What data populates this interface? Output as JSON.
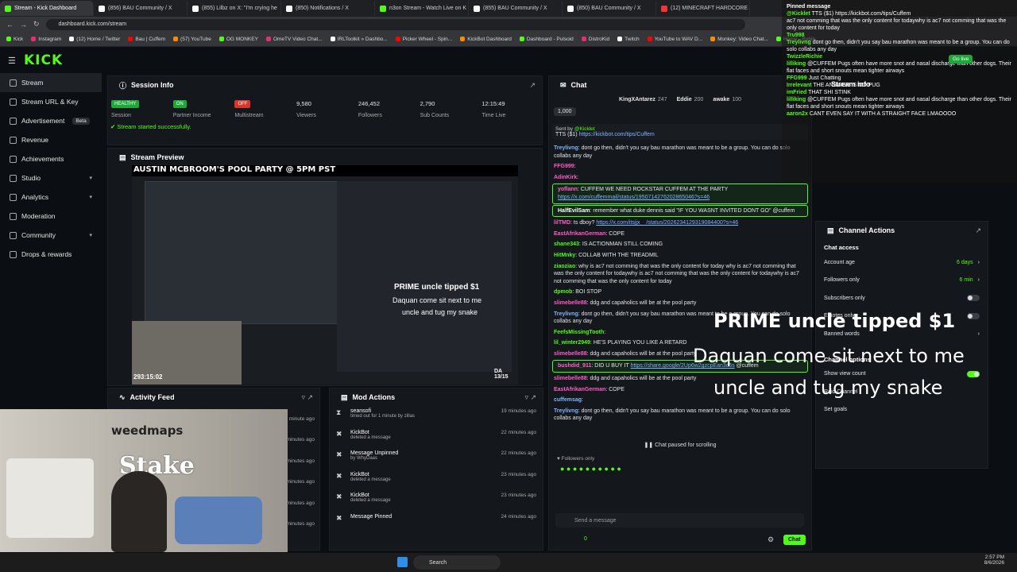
{
  "browser": {
    "tabs": [
      {
        "label": "Stream - Kick Dashboard",
        "color": "#53fc18",
        "active": true
      },
      {
        "label": "(856) BAU Community / X",
        "color": "#ffffff"
      },
      {
        "label": "(855) Lilbz on X: \"I'm crying he",
        "color": "#ffffff"
      },
      {
        "label": "(850) Notifications / X",
        "color": "#ffffff"
      },
      {
        "label": "n3on Stream - Watch Live on K",
        "color": "#53fc18"
      },
      {
        "label": "(855) BAU Community / X",
        "color": "#ffffff"
      },
      {
        "label": "(850) BAU Community / X",
        "color": "#ffffff"
      },
      {
        "label": "(12) MINECRAFT HARDCORE A",
        "color": "#ff3333"
      }
    ],
    "url": "dashboard.kick.com/stream",
    "bookmarks": [
      "Kick",
      "Instagram",
      "(12) Home / Twitter",
      "Bau | Cuffem",
      "(57) YouTube",
      "OG MONKEY",
      "OmeTV Video Chat...",
      "IRLToolkit » Dashbo...",
      "Picker Wheel - Spin...",
      "KickBot Dashboard",
      "Dashboard - Pulsoid",
      "DistroKid",
      "Twitch",
      "YouTube to WAV D...",
      "Monkey: Video Chat...",
      "Home - Rubik..."
    ]
  },
  "brand": {
    "logo": "KICK",
    "accent": "#53fc18"
  },
  "sidebar": {
    "items": [
      {
        "label": "Stream",
        "active": true,
        "icon": "stream-icon"
      },
      {
        "label": "Stream URL & Key",
        "icon": "key-icon"
      },
      {
        "label": "Advertisement",
        "badge": "Beta",
        "icon": "ad-icon"
      },
      {
        "label": "Revenue",
        "icon": "revenue-icon"
      },
      {
        "label": "Achievements",
        "icon": "trophy-icon"
      },
      {
        "label": "Studio",
        "chevron": true,
        "icon": "studio-icon"
      },
      {
        "label": "Analytics",
        "chevron": true,
        "icon": "analytics-icon"
      },
      {
        "label": "Moderation",
        "icon": "shield-icon"
      },
      {
        "label": "Community",
        "chevron": true,
        "icon": "community-icon"
      },
      {
        "label": "Drops & rewards",
        "icon": "gift-icon"
      }
    ]
  },
  "session": {
    "title": "Session Info",
    "stats": [
      {
        "value": "HEALTHY",
        "pill": "#1fa83a",
        "label": "Session"
      },
      {
        "value": "ON",
        "pill": "#1fa83a",
        "label": "Partner Income"
      },
      {
        "value": "OFF",
        "pill": "#d9362b",
        "label": "Multistream"
      },
      {
        "value": "9,580",
        "label": "Viewers"
      },
      {
        "value": "246,452",
        "label": "Followers"
      },
      {
        "value": "2,790",
        "label": "Sub Counts"
      },
      {
        "value": "12:15:49",
        "label": "Time Live"
      }
    ],
    "status": "Stream started successfully."
  },
  "preview": {
    "title": "Stream Preview",
    "banner": "AUSTIN MCBROOM'S POOL PARTY @ 5PM PST",
    "tip_title": "PRIME uncle tipped $1",
    "tip_msg1": "Daquan come sit next to me",
    "tip_msg2": "uncle and tug my snake",
    "clock": "293:15:02",
    "counter": "DA 13/15"
  },
  "activity": {
    "title": "Activity Feed",
    "times": [
      "1 minute ago",
      "minutes ago",
      "minutes ago",
      "minutes ago",
      "minutes ago",
      "minutes ago"
    ],
    "webcam_sponsor": "weedmaps",
    "webcam_brand": "Stake"
  },
  "mod": {
    "title": "Mod Actions",
    "rows": [
      {
        "t": "seansofi",
        "s": "timed out for 1 minute by zillas",
        "time": "19 minutes ago",
        "icon": "hourglass-icon"
      },
      {
        "t": "KickBot",
        "s": "deleted a message",
        "time": "22 minutes ago",
        "icon": "trash-icon"
      },
      {
        "t": "Message Unpinned",
        "s": "by WhyDaas",
        "time": "22 minutes ago",
        "icon": "unpin-icon"
      },
      {
        "t": "KickBot",
        "s": "deleted a message",
        "time": "23 minutes ago",
        "icon": "trash-icon"
      },
      {
        "t": "KickBot",
        "s": "deleted a message",
        "time": "23 minutes ago",
        "icon": "trash-icon"
      },
      {
        "t": "Message Pinned",
        "s": "",
        "time": "24 minutes ago",
        "icon": "pin-icon"
      }
    ]
  },
  "chat": {
    "title": "Chat",
    "top": [
      {
        "name": "KingXAntarez",
        "value": "247"
      },
      {
        "name": "Eddie",
        "value": "200"
      },
      {
        "name": "awake",
        "value": "100"
      }
    ],
    "goal": "1,000",
    "pinned_by": "Sent by",
    "pinned_user": "@Kicklet",
    "pinned_prefix": "TTS ($1)",
    "pinned_link": "https://kickbot.com/tips/Cuffem",
    "messages": [
      {
        "u": "Treylivng",
        "c": "#7fb6ff",
        "m": "dont go then, didn't you say bau marathon was meant to be a group. You can do solo collabs any day"
      },
      {
        "u": "FFG999",
        "c": "#ff5fc8",
        "m": ""
      },
      {
        "u": "AdinKirk",
        "c": "#ff5fc8",
        "m": ""
      },
      {
        "u": "yoflann",
        "c": "#ff5fc8",
        "m": "CUFFEM WE NEED ROCKSTAR CUFFEM AT THE PARTY",
        "link": "https://x.com/cuffemmail/status/1950714276202865046?s=46",
        "hl": true
      },
      {
        "u": "HalfEvilSam",
        "c": "#ffffff",
        "m": "remember what duke dennis said \"IF YOU WASNT INVITED DONT GO\" @cuffem",
        "hl": true
      },
      {
        "u": "lilTMD",
        "c": "#ff5fc8",
        "m": "ts dboy?",
        "link": "https://x.com/itsjjx__/status/2026234129319084400?s=46"
      },
      {
        "u": "EastAfrikanGerman",
        "c": "#ff5fc8",
        "m": "COPE"
      },
      {
        "u": "shane343",
        "c": "#53fc18",
        "m": "IS ACTIONMAN STILL COMING"
      },
      {
        "u": "HitMnky",
        "c": "#53fc18",
        "m": "COLLAB WITH THE TREADMIL"
      },
      {
        "u": "ziaoziao",
        "c": "#53fc18",
        "m": "why is ac7 not comming that was the only content for today why is ac7 not comming that was the only content for todaywhy is ac7 not comming that was the only content for todaywhy is ac7 not comming that was the only content for today"
      },
      {
        "u": "dpmob",
        "c": "#53fc18",
        "m": "BOI STOP"
      },
      {
        "u": "slimebelle88",
        "c": "#ff5fc8",
        "m": "ddg and capaholics will be at the pool party"
      },
      {
        "u": "Treylivng",
        "c": "#7fb6ff",
        "m": "dont go then, didn't you say bau marathon was meant to be a group. You can do solo collabs any day"
      },
      {
        "u": "FeefsMissingTooth",
        "c": "#53fc18",
        "m": ""
      },
      {
        "u": "lil_winter2949",
        "c": "#53fc18",
        "m": "HE'S PLAYING YOU LIKE A RETARD"
      },
      {
        "u": "slimebelle88",
        "c": "#ff5fc8",
        "m": "ddg and capaholics will be at the pool party"
      },
      {
        "u": "bushdid_911",
        "c": "#ff5fc8",
        "m": "DID U BUY IT",
        "link": "https://share.google/2Up6w2gzcpEan3c5s",
        "tail": "@cuffem",
        "hl": true
      },
      {
        "u": "slimebelle88",
        "c": "#ff5fc8",
        "m": "ddg and capaholics will be at the pool party"
      },
      {
        "u": "EastAfrikanGerman",
        "c": "#ff5fc8",
        "m": "COPE"
      },
      {
        "u": "cuffemsag",
        "c": "#7fb6ff",
        "m": ""
      },
      {
        "u": "Treylivng",
        "c": "#7fb6ff",
        "m": "dont go then, didn't you say bau marathon was meant to be a group. You can do solo collabs any day"
      }
    ],
    "paused": "Chat paused for scrolling",
    "followers_only": "Followers only",
    "input_placeholder": "Send a message",
    "send_label": "Chat",
    "points": "0"
  },
  "channel": {
    "title": "Channel Actions",
    "access_title": "Chat access",
    "rows": [
      {
        "label": "Account age",
        "value": "6 days"
      },
      {
        "label": "Followers only",
        "value": "6 min"
      },
      {
        "label": "Subscribers only",
        "toggle": false
      },
      {
        "label": "Emotes only",
        "toggle": false
      },
      {
        "label": "Banned words",
        "value": ""
      }
    ],
    "options_title": "Channel options",
    "options": [
      {
        "label": "Show view count",
        "toggle": true
      },
      {
        "label": "Raid Channel"
      },
      {
        "label": "Set goals"
      }
    ]
  },
  "overlay": {
    "title": "Pinned message",
    "lines": [
      {
        "u": "@Kicklet",
        "m": "TTS ($1) https://kickbot.com/tips/Cuffem"
      },
      {
        "u": "",
        "m": "ac7 not comming that was the only content for todaywhy is ac7 not comming that was the only content for today"
      },
      {
        "u": "Tru998",
        "m": ""
      },
      {
        "u": "Treylivng",
        "m": "dont go then, didn't you say bau marathon was meant to be a group. You can do solo collabs any day"
      },
      {
        "u": "TwizzleRichie",
        "m": ""
      },
      {
        "u": "lilliking",
        "m": "@CUFFEM Pugs often have more snot and nasal discharge than other dogs. Their flat faces and short snouts mean tighter airways"
      },
      {
        "u": "FFG999",
        "m": "Just Chatting"
      },
      {
        "u": "Irrelevant",
        "m": "THE ANSWER IS NO PUG"
      },
      {
        "u": "imFried",
        "m": "THAT SHI STINK"
      },
      {
        "u": "lilliking",
        "m": "@CUFFEM Pugs often have more snot and nasal discharge than other dogs. Their flat faces and short snouts mean tighter airways"
      },
      {
        "u": "aaron2x",
        "m": "CANT EVEN SAY IT WITH A STRAIGHT FACE LMAOOOO"
      }
    ],
    "go_live": "Go live",
    "stream_info": "Stream info"
  },
  "taskbar": {
    "search": "Search",
    "time": "2:57 PM",
    "date": "8/6/2026"
  }
}
